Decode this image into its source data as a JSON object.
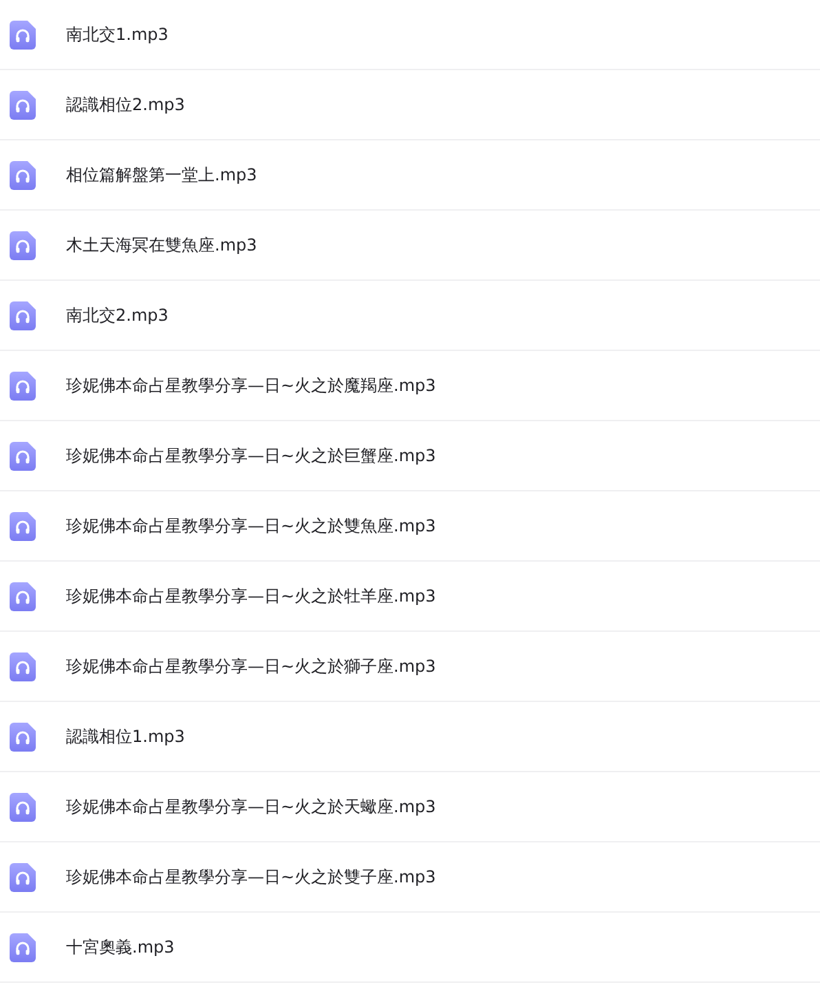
{
  "files": [
    {
      "name": "南北交1.mp3"
    },
    {
      "name": "認識相位2.mp3"
    },
    {
      "name": "相位篇解盤第一堂上.mp3"
    },
    {
      "name": "木土天海冥在雙魚座.mp3"
    },
    {
      "name": "南北交2.mp3"
    },
    {
      "name": "珍妮佛本命占星教學分享—日~火之於魔羯座.mp3"
    },
    {
      "name": "珍妮佛本命占星教學分享—日~火之於巨蟹座.mp3"
    },
    {
      "name": "珍妮佛本命占星教學分享—日~火之於雙魚座.mp3"
    },
    {
      "name": "珍妮佛本命占星教學分享—日~火之於牡羊座.mp3"
    },
    {
      "name": "珍妮佛本命占星教學分享—日~火之於獅子座.mp3"
    },
    {
      "name": "認識相位1.mp3"
    },
    {
      "name": "珍妮佛本命占星教學分享—日~火之於天蠍座.mp3"
    },
    {
      "name": "珍妮佛本命占星教學分享—日~火之於雙子座.mp3"
    },
    {
      "name": "十宮奧義.mp3"
    }
  ]
}
